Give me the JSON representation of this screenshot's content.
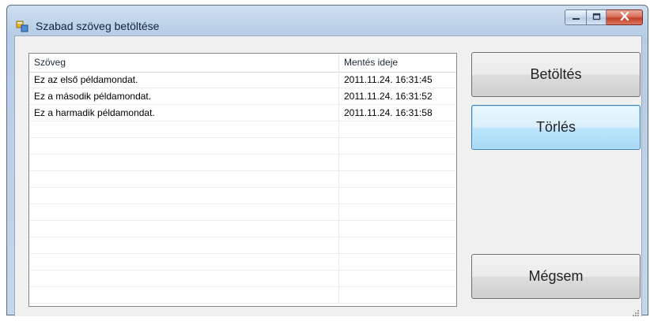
{
  "window": {
    "title": "Szabad szöveg betöltése",
    "accent_color": "#b9cfe7",
    "close_color": "#c4402a"
  },
  "listview": {
    "columns": [
      "Szöveg",
      "Mentés ideje"
    ],
    "rows": [
      {
        "text": "Ez az első példamondat.",
        "time": "2011.11.24. 16:31:45"
      },
      {
        "text": "Ez a második példamondat.",
        "time": "2011.11.24. 16:31:52"
      },
      {
        "text": "Ez a harmadik példamondat.",
        "time": "2011.11.24. 16:31:58"
      }
    ]
  },
  "buttons": {
    "load": "Betöltés",
    "delete": "Törlés",
    "cancel": "Mégsem"
  },
  "icons": {
    "app": "form-icon",
    "minimize": "minimize-icon",
    "maximize": "maximize-icon",
    "close": "close-icon",
    "grip": "size-grip-icon"
  }
}
